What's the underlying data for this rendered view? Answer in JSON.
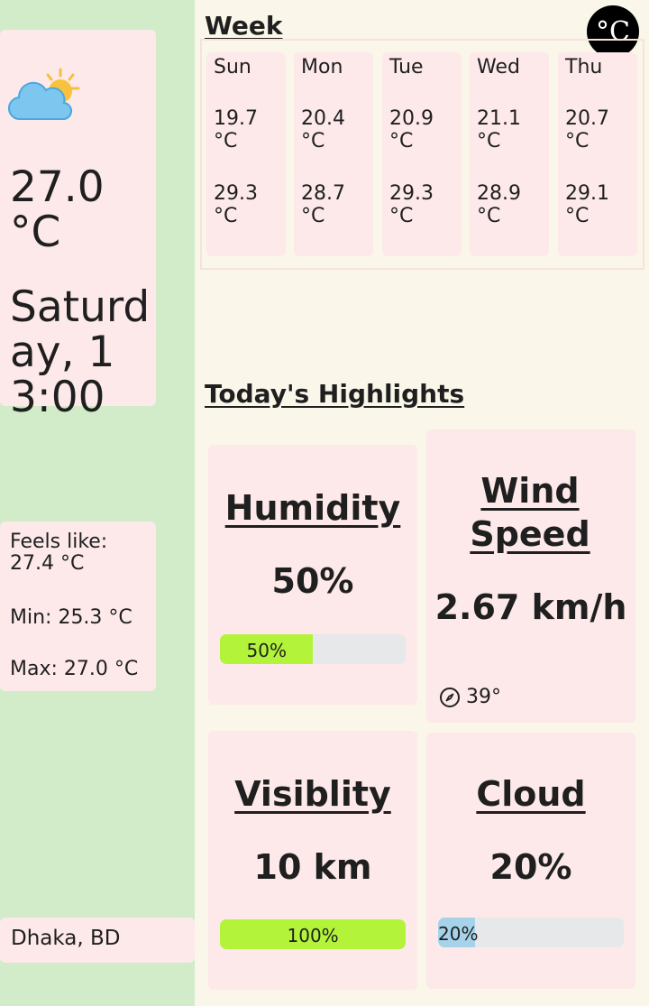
{
  "current": {
    "icon": "partly-cloudy-icon",
    "temperature": "27.0 °C",
    "datetime": "Saturday, 13:00"
  },
  "details": {
    "feels_like": "Feels like: 27.4 °C",
    "min": "Min: 25.3 °C",
    "max": "Max: 27.0 °C"
  },
  "location": "Dhaka, BD",
  "unit_toggle": "°C",
  "week": {
    "title": "Week",
    "days": [
      {
        "name": "Sun",
        "min": "19.7 °C",
        "max": "29.3 °C"
      },
      {
        "name": "Mon",
        "min": "20.4 °C",
        "max": "28.7 °C"
      },
      {
        "name": "Tue",
        "min": "20.9 °C",
        "max": "29.3 °C"
      },
      {
        "name": "Wed",
        "min": "21.1 °C",
        "max": "28.9 °C"
      },
      {
        "name": "Thu",
        "min": "20.7 °C",
        "max": "29.1 °C"
      }
    ]
  },
  "highlights": {
    "title": "Today's Highlights",
    "humidity": {
      "title": "Humidity",
      "value": "50%",
      "bar_label": "50%",
      "level": 0.5,
      "bar_color": "#b3f43a"
    },
    "wind": {
      "title": "Wind Speed",
      "value": "2.67 km/h",
      "direction": "39°",
      "icon": "compass-icon"
    },
    "visibility": {
      "title": "Visiblity",
      "value": "10 km",
      "bar_label": "100%",
      "level": 1.0,
      "bar_color": "#b3f43a"
    },
    "cloud": {
      "title": "Cloud",
      "value": "20%",
      "bar_label": "20%",
      "level": 0.2,
      "bar_color": "#a6d3ea"
    }
  },
  "colors": {
    "sidebar": "#d2ecc9",
    "card": "#fde9ea",
    "main_bg": "#faf6e9"
  }
}
